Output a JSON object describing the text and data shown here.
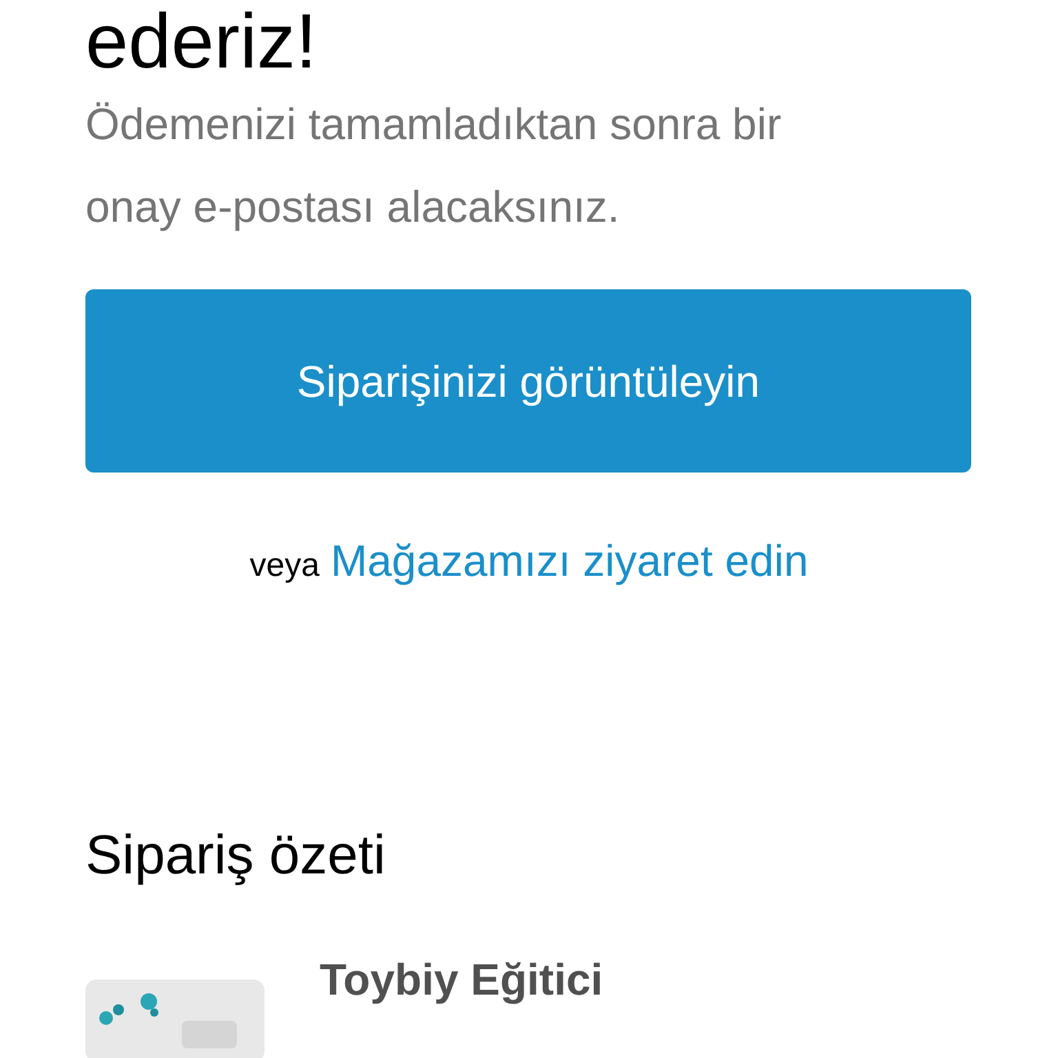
{
  "title": "ederiz!",
  "message": "Ödemenizi tamamladıktan sonra bir onay e-postası alacaksınız.",
  "view_order_button": "Siparişinizi görüntüleyin",
  "alternative": {
    "prefix": "veya",
    "link": "Mağazamızı ziyaret edin"
  },
  "order_summary": {
    "heading": "Sipariş özeti",
    "items": [
      {
        "name": "Toybiy Eğitici",
        "kind": "picture"
      }
    ]
  }
}
